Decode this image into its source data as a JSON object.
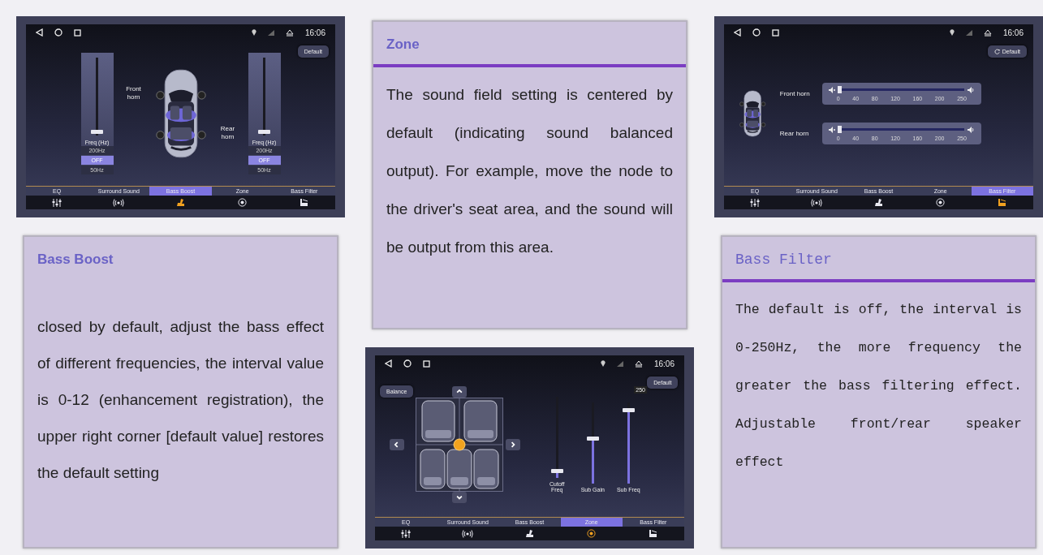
{
  "columns": [
    {
      "panels": [
        {
          "screen": {
            "time": "16:06",
            "default_button": "Default",
            "bass_boost": {
              "channels": [
                {
                  "label": "Front horn",
                  "level": 0.04,
                  "freq_heading": "Freq (Hz)",
                  "options": [
                    {
                      "label": "200Hz",
                      "selected": false
                    },
                    {
                      "label": "OFF",
                      "selected": true
                    },
                    {
                      "label": "50Hz",
                      "selected": false
                    }
                  ]
                },
                {
                  "label": "Rear horn",
                  "level": 0.04,
                  "freq_heading": "Freq (Hz)",
                  "options": [
                    {
                      "label": "200Hz",
                      "selected": false
                    },
                    {
                      "label": "OFF",
                      "selected": true
                    },
                    {
                      "label": "50Hz",
                      "selected": false
                    }
                  ]
                }
              ]
            },
            "tabs": [
              {
                "label": "EQ",
                "selected": false
              },
              {
                "label": "Surround Sound",
                "selected": false
              },
              {
                "label": "Bass Boost",
                "selected": true
              },
              {
                "label": "Zone",
                "selected": false
              },
              {
                "label": "Bass Filter",
                "selected": false
              }
            ]
          }
        },
        {
          "card": {
            "title": "Bass Boost",
            "ruled": false,
            "text": "closed by default, adjust the bass effect of different frequencies, the interval value is 0-12 (enhancement registration), the upper right corner [default value] restores the default setting"
          }
        }
      ]
    },
    {
      "panels": [
        {
          "card": {
            "title": "Zone",
            "ruled": true,
            "text": "The sound field setting is centered by default (indicating sound balanced output). For example, move the node to the driver's seat area, and the sound will be output from this area."
          }
        },
        {
          "screen": {
            "time": "16:06",
            "default_button": "Default",
            "zone": {
              "balance_button": "Balance",
              "sliders": [
                {
                  "label": "Cutoff Freq",
                  "level": 0.08
                },
                {
                  "label": "Sub Gain",
                  "level": 0.55
                },
                {
                  "label": "Sub Freq",
                  "level": 0.9,
                  "value": "250"
                }
              ]
            },
            "tabs": [
              {
                "label": "EQ",
                "selected": false
              },
              {
                "label": "Surround Sound",
                "selected": false
              },
              {
                "label": "Bass Boost",
                "selected": false
              },
              {
                "label": "Zone",
                "selected": true
              },
              {
                "label": "Bass Filter",
                "selected": false
              }
            ]
          }
        }
      ]
    },
    {
      "panels": [
        {
          "screen": {
            "time": "16:06",
            "default_button": "Default",
            "bass_filter": {
              "channels": [
                {
                  "label": "Front horn",
                  "level": 0.0,
                  "ticks": [
                    "0",
                    "40",
                    "80",
                    "120",
                    "160",
                    "200",
                    "250"
                  ]
                },
                {
                  "label": "Rear horn",
                  "level": 0.0,
                  "ticks": [
                    "0",
                    "40",
                    "80",
                    "120",
                    "160",
                    "200",
                    "250"
                  ]
                }
              ]
            },
            "tabs": [
              {
                "label": "EQ",
                "selected": false
              },
              {
                "label": "Surround Sound",
                "selected": false
              },
              {
                "label": "Bass Boost",
                "selected": false
              },
              {
                "label": "Zone",
                "selected": false
              },
              {
                "label": "Bass Filter",
                "selected": true
              }
            ]
          }
        },
        {
          "card": {
            "title": "Bass Filter",
            "ruled": true,
            "text": "The default is off, the interval is 0-250Hz, the more frequency the greater the bass filtering effect. Adjustable front/rear speaker effect"
          }
        }
      ]
    }
  ]
}
